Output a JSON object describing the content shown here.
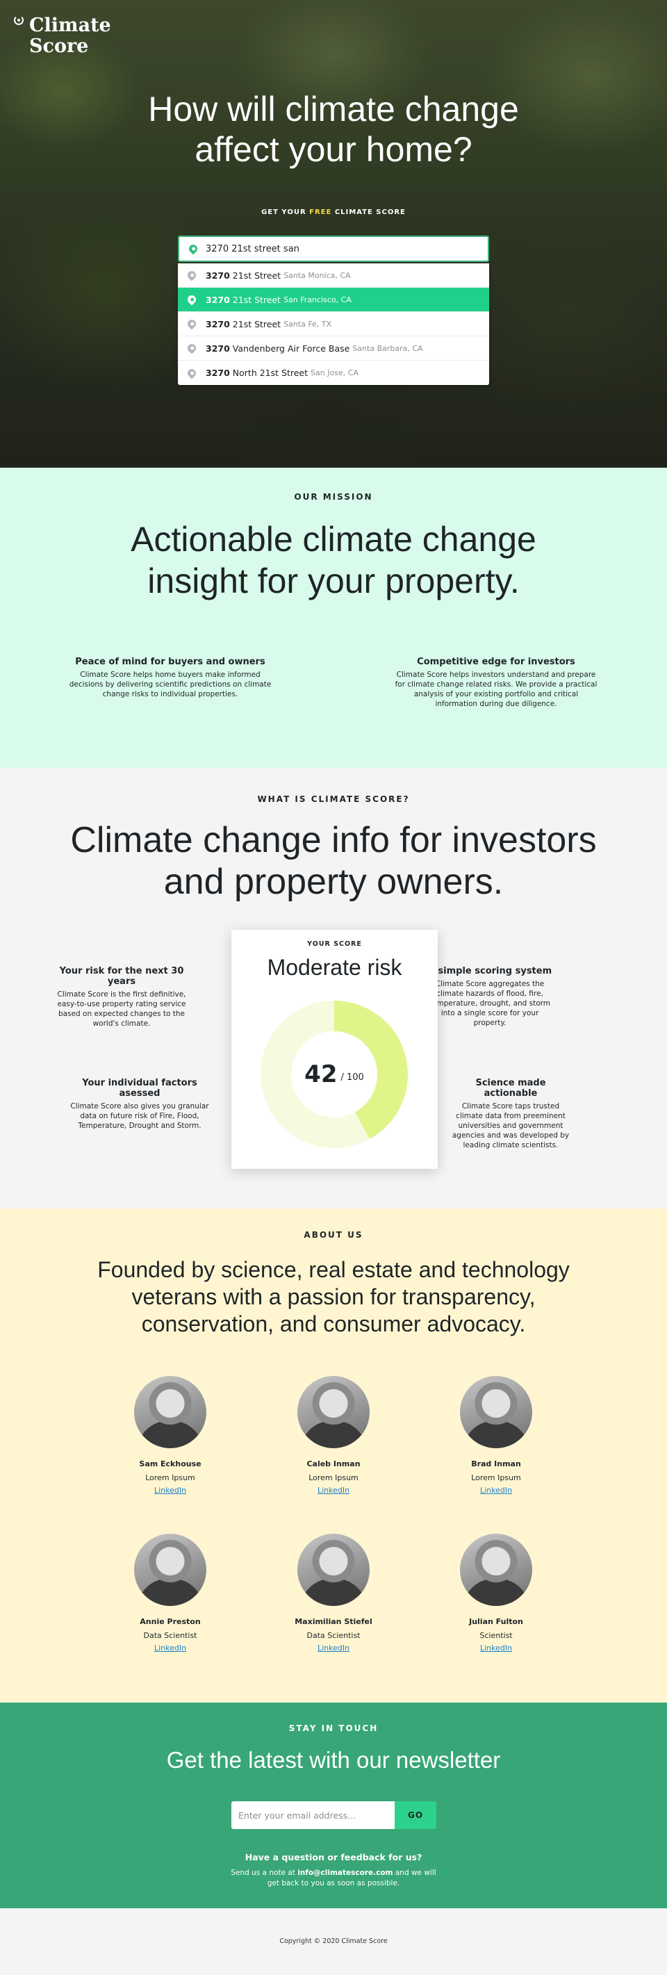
{
  "brand": {
    "line1": "Climate",
    "line2": "Score"
  },
  "hero": {
    "title_line1": "How will climate change",
    "title_line2": "affect your home?",
    "cta_prefix": "GET YOUR",
    "cta_free": "FREE",
    "cta_suffix": "CLIMATE SCORE",
    "search_value": "3270 21st street san",
    "suggestions": [
      {
        "bold": "3270",
        "street": "21st Street",
        "location": "Santa Monica, CA",
        "active": false
      },
      {
        "bold": "3270",
        "street": "21st Street",
        "location": "San Francisco, CA",
        "active": true
      },
      {
        "bold": "3270",
        "street": "21st Street",
        "location": "Santa Fe, TX",
        "active": false
      },
      {
        "bold": "3270",
        "street": "Vandenberg Air Force Base",
        "location": "Santa Barbara, CA",
        "active": false
      },
      {
        "bold": "3270",
        "street": "North 21st Street",
        "location": "San Jose, CA",
        "active": false
      }
    ]
  },
  "mission": {
    "eyebrow": "OUR MISSION",
    "title_line1": "Actionable climate change",
    "title_line2": "insight for your property.",
    "features": [
      {
        "title": "Peace of mind for buyers and owners",
        "text": "Climate Score helps home buyers make informed decisions by delivering scientific predictions on climate change risks to individual properties."
      },
      {
        "title": "Competitive edge for investors",
        "text": "Climate Score helps investors understand and prepare for climate change related risks. We provide a practical analysis of your existing portfolio and critical information during due diligence."
      }
    ]
  },
  "whatis": {
    "eyebrow": "WHAT IS CLIMATE SCORE?",
    "title_line1": "Climate change info for investors",
    "title_line2": "and property owners.",
    "card": {
      "label": "YOUR SCORE",
      "level": "Moderate risk",
      "score": "42",
      "out_of": "/ 100",
      "score_fraction": 0.42
    },
    "features": [
      {
        "title": "Your risk for the next 30 years",
        "text": "Climate Score is the first definitive, easy-to-use property rating service based on expected changes to the world's climate."
      },
      {
        "title": "A simple scoring system",
        "text": "Climate Score aggregates the climate hazards of flood, fire, temperature, drought, and storm into a single score for your property."
      },
      {
        "title": "Your individual factors asessed",
        "text": "Climate Score also gives you granular data on future risk of Fire, Flood, Temperature, Drought and Storm."
      },
      {
        "title": "Science made actionable",
        "text": "Climate Score taps trusted climate data from preeminent universities and government agencies and was developed by leading climate scientists."
      }
    ]
  },
  "about": {
    "eyebrow": "ABOUT US",
    "title_line1": "Founded by science, real estate and technology",
    "title_line2": "veterans with a passion for transparency,",
    "title_line3": "conservation, and consumer advocacy.",
    "team": [
      {
        "name": "Sam Eckhouse",
        "role": "Lorem Ipsum",
        "link": "LinkedIn"
      },
      {
        "name": "Caleb Inman",
        "role": "Lorem Ipsum",
        "link": "LinkedIn"
      },
      {
        "name": "Brad Inman",
        "role": "Lorem Ipsum",
        "link": "LinkedIn"
      },
      {
        "name": "Annie Preston",
        "role": "Data Scientist",
        "link": "LinkedIn"
      },
      {
        "name": "Maximilian Stiefel",
        "role": "Data Scientist",
        "link": "LinkedIn"
      },
      {
        "name": "Julian Fulton",
        "role": "Scientist",
        "link": "LinkedIn"
      }
    ]
  },
  "newsletter": {
    "eyebrow": "STAY IN TOUCH",
    "title": "Get the latest with our newsletter",
    "email_placeholder": "Enter your email address...",
    "button": "GO",
    "question": "Have a question or feedback for us?",
    "note_prefix": "Send us a note at",
    "note_email": "info@climatescore.com",
    "note_suffix": "and we will get back to you as soon as possible."
  },
  "footer": {
    "copyright": "Copyright © 2020 Climate Score"
  },
  "colors": {
    "accent_green": "#1fd08a",
    "mission_bg": "#d8fbeb",
    "about_bg": "#fff6d1",
    "newsletter_bg": "#38a677",
    "donut_fill": "#dff58a",
    "donut_track": "#f6fbdf"
  }
}
